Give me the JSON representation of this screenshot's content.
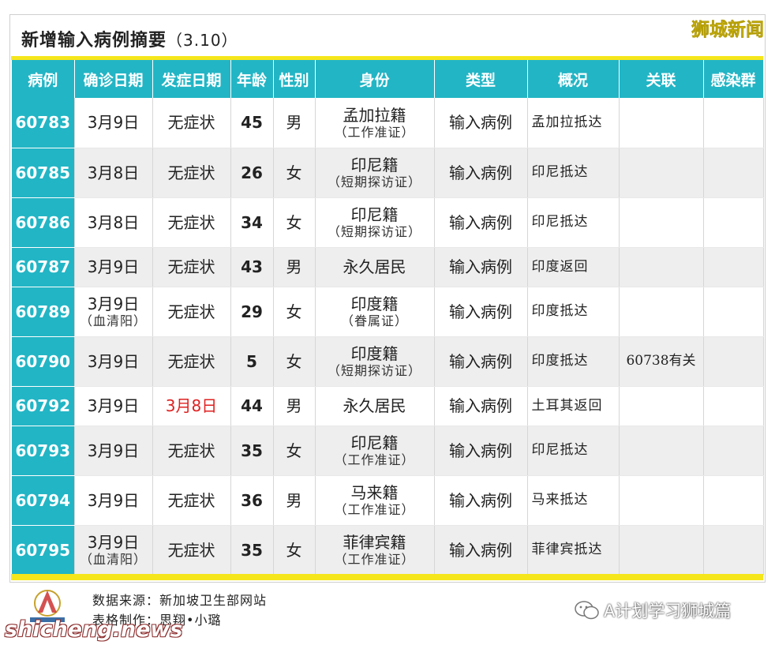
{
  "header": {
    "title": "新增输入病例摘要",
    "title_date": "（3.10）",
    "brand": "狮城新闻"
  },
  "table": {
    "columns": [
      "病例",
      "确诊日期",
      "发症日期",
      "年龄",
      "性别",
      "身份",
      "类型",
      "概况",
      "关联",
      "感染群"
    ],
    "rows": [
      {
        "id": "60783",
        "confirm": "3月9日",
        "confirm_note": "",
        "onset": "无症状",
        "age": "45",
        "sex": "男",
        "identity": "孟加拉籍",
        "identity_note": "（工作准证）",
        "type": "输入病例",
        "overview": "孟加拉抵达",
        "link": "",
        "cluster": ""
      },
      {
        "id": "60785",
        "confirm": "3月8日",
        "confirm_note": "",
        "onset": "无症状",
        "age": "26",
        "sex": "女",
        "identity": "印尼籍",
        "identity_note": "（短期探访证）",
        "type": "输入病例",
        "overview": "印尼抵达",
        "link": "",
        "cluster": ""
      },
      {
        "id": "60786",
        "confirm": "3月8日",
        "confirm_note": "",
        "onset": "无症状",
        "age": "34",
        "sex": "女",
        "identity": "印尼籍",
        "identity_note": "（短期探访证）",
        "type": "输入病例",
        "overview": "印尼抵达",
        "link": "",
        "cluster": ""
      },
      {
        "id": "60787",
        "confirm": "3月9日",
        "confirm_note": "",
        "onset": "无症状",
        "age": "43",
        "sex": "男",
        "identity": "永久居民",
        "identity_note": "",
        "type": "输入病例",
        "overview": "印度返回",
        "link": "",
        "cluster": ""
      },
      {
        "id": "60789",
        "confirm": "3月9日",
        "confirm_note": "（血清阳）",
        "onset": "无症状",
        "age": "29",
        "sex": "女",
        "identity": "印度籍",
        "identity_note": "（眷属证）",
        "type": "输入病例",
        "overview": "印度抵达",
        "link": "",
        "cluster": ""
      },
      {
        "id": "60790",
        "confirm": "3月9日",
        "confirm_note": "",
        "onset": "无症状",
        "age": "5",
        "sex": "女",
        "identity": "印度籍",
        "identity_note": "（短期探访证）",
        "type": "输入病例",
        "overview": "印度抵达",
        "link": "60738有关",
        "cluster": ""
      },
      {
        "id": "60792",
        "confirm": "3月9日",
        "confirm_note": "",
        "onset": "3月8日",
        "age": "44",
        "sex": "男",
        "identity": "永久居民",
        "identity_note": "",
        "type": "输入病例",
        "overview": "土耳其返回",
        "link": "",
        "cluster": ""
      },
      {
        "id": "60793",
        "confirm": "3月9日",
        "confirm_note": "",
        "onset": "无症状",
        "age": "35",
        "sex": "女",
        "identity": "印尼籍",
        "identity_note": "（工作准证）",
        "type": "输入病例",
        "overview": "印尼抵达",
        "link": "",
        "cluster": ""
      },
      {
        "id": "60794",
        "confirm": "3月9日",
        "confirm_note": "",
        "onset": "无症状",
        "age": "36",
        "sex": "男",
        "identity": "马来籍",
        "identity_note": "（工作准证）",
        "type": "输入病例",
        "overview": "马来抵达",
        "link": "",
        "cluster": ""
      },
      {
        "id": "60795",
        "confirm": "3月9日",
        "confirm_note": "（血清阳）",
        "onset": "无症状",
        "age": "35",
        "sex": "女",
        "identity": "菲律宾籍",
        "identity_note": "（工作准证）",
        "type": "输入病例",
        "overview": "菲律宾抵达",
        "link": "",
        "cluster": ""
      }
    ]
  },
  "footer": {
    "source": "数据来源：新加坡卫生部网站",
    "author": "表格制作：思翔•小璐",
    "wechat": "A计划学习狮城篇",
    "watermark": "shicheng.news"
  },
  "colors": {
    "header_bg": "#22b5c5",
    "accent_yellow": "#f5e61c",
    "highlight_red": "#e02020"
  }
}
